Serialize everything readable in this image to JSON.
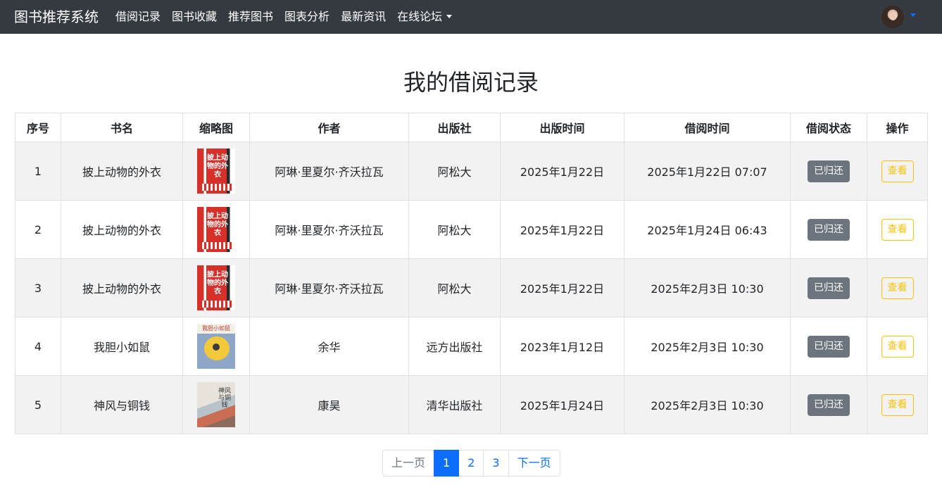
{
  "navbar": {
    "brand": "图书推荐系统",
    "items": [
      {
        "label": "借阅记录"
      },
      {
        "label": "图书收藏"
      },
      {
        "label": "推荐图书"
      },
      {
        "label": "图表分析"
      },
      {
        "label": "最新资讯"
      },
      {
        "label": "在线论坛",
        "dropdown": true
      }
    ]
  },
  "page_title": "我的借阅记录",
  "table": {
    "headers": [
      "序号",
      "书名",
      "缩略图",
      "作者",
      "出版社",
      "出版时间",
      "借阅时间",
      "借阅状态",
      "操作"
    ],
    "rows": [
      {
        "index": "1",
        "title": "披上动物的外衣",
        "cover": "red",
        "cover_text": "披上动物的外衣",
        "author": "阿琳·里夏尔·齐沃拉瓦",
        "publisher": "阿松大",
        "pub_date": "2025年1月22日",
        "borrow_time": "2025年1月22日 07:07",
        "status": "已归还",
        "action": "查看"
      },
      {
        "index": "2",
        "title": "披上动物的外衣",
        "cover": "red",
        "cover_text": "披上动物的外衣",
        "author": "阿琳·里夏尔·齐沃拉瓦",
        "publisher": "阿松大",
        "pub_date": "2025年1月22日",
        "borrow_time": "2025年1月24日 06:43",
        "status": "已归还",
        "action": "查看"
      },
      {
        "index": "3",
        "title": "披上动物的外衣",
        "cover": "red",
        "cover_text": "披上动物的外衣",
        "author": "阿琳·里夏尔·齐沃拉瓦",
        "publisher": "阿松大",
        "pub_date": "2025年1月22日",
        "borrow_time": "2025年2月3日 10:30",
        "status": "已归还",
        "action": "查看"
      },
      {
        "index": "4",
        "title": "我胆小如鼠",
        "cover": "yellow",
        "cover_text": "我胆小如鼠",
        "author": "余华",
        "publisher": "远方出版社",
        "pub_date": "2023年1月12日",
        "borrow_time": "2025年2月3日 10:30",
        "status": "已归还",
        "action": "查看"
      },
      {
        "index": "5",
        "title": "神风与铜钱",
        "cover": "ink",
        "cover_text": "神风与铜钱",
        "author": "康昊",
        "publisher": "清华出版社",
        "pub_date": "2025年1月24日",
        "borrow_time": "2025年2月3日 10:30",
        "status": "已归还",
        "action": "查看"
      }
    ]
  },
  "pagination": {
    "prev": "上一页",
    "pages": [
      "1",
      "2",
      "3"
    ],
    "active_page": "1",
    "next": "下一页"
  },
  "colors": {
    "navbar_bg": "#343a40",
    "primary": "#0d6efd",
    "status_badge": "#6c757d",
    "view_button": "#ffc107"
  }
}
